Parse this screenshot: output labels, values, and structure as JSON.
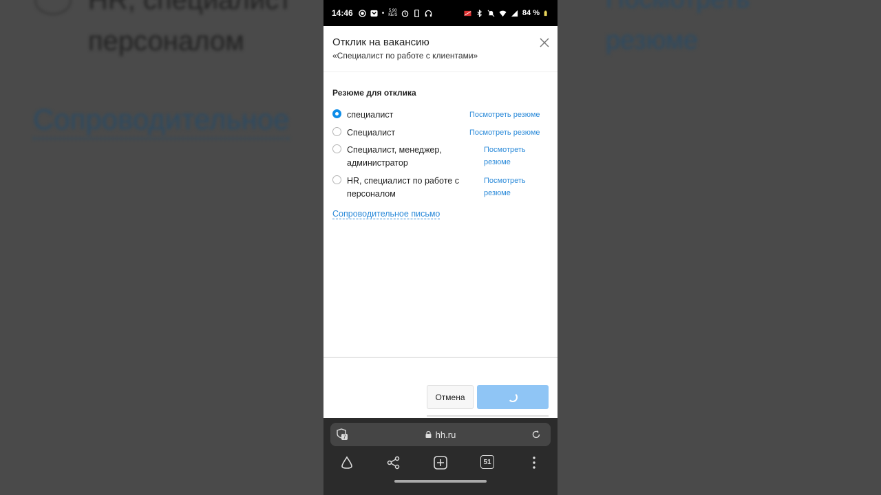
{
  "background": {
    "left_line1": "HR, специалист",
    "left_line2": "персоналом",
    "left_link": "Сопроводительное",
    "right_line1": "Посмотреть",
    "right_line2": "резюме"
  },
  "statusbar": {
    "time": "14:46",
    "net_speed": "5.90",
    "net_unit": "КБ/S",
    "battery": "84 %"
  },
  "modal": {
    "title": "Отклик на вакансию",
    "subtitle": "«Специалист по работе с клиентами»",
    "section_label": "Резюме для отклика",
    "resumes": [
      {
        "name": "специалист",
        "selected": true,
        "link": "Посмотреть резюме"
      },
      {
        "name": "Специалист",
        "selected": false,
        "link": "Посмотреть резюме"
      },
      {
        "name": "Специалист, менеджер, администратор",
        "selected": false,
        "link": "Посмотреть резюме"
      },
      {
        "name": "HR, специалист по работе с персоналом",
        "selected": false,
        "link": "Посмотреть резюме"
      }
    ],
    "cover_letter_link": "Сопроводительное письмо",
    "cancel_label": "Отмена"
  },
  "browser": {
    "url": "hh.ru",
    "shield_count": "7",
    "tab_count": "51"
  },
  "colors": {
    "accent": "#2b8ad9",
    "radio_checked": "#0e8de8",
    "submit_disabled": "#8fc5f5"
  }
}
